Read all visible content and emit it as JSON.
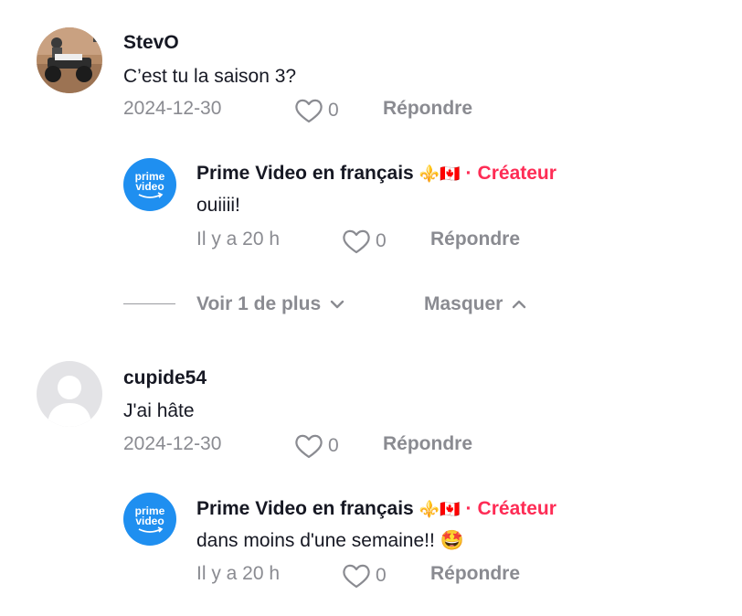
{
  "comments": [
    {
      "username": "StevO",
      "avatar_icon": "atv-photo",
      "text": "C’est tu la saison 3?",
      "date": "2024-12-30",
      "likes": "0",
      "reply_label": "Répondre",
      "reply": {
        "username": "Prime Video en français",
        "avatar_icon": "prime-video-logo",
        "avatar_text_line1": "prime",
        "avatar_text_line2": "video",
        "flags": "⚜️🇨🇦",
        "separator": "·",
        "badge": "Créateur",
        "text": "ouiiii!",
        "time": "Il y a 20 h",
        "likes": "0",
        "reply_label": "Répondre"
      },
      "thread_controls": {
        "more_label": "Voir 1 de plus",
        "hide_label": "Masquer"
      }
    },
    {
      "username": "cupide54",
      "avatar_icon": "default-avatar",
      "text": "J'ai hâte",
      "date": "2024-12-30",
      "likes": "0",
      "reply_label": "Répondre",
      "reply": {
        "username": "Prime Video en français",
        "avatar_icon": "prime-video-logo",
        "avatar_text_line1": "prime",
        "avatar_text_line2": "video",
        "flags": "⚜️🇨🇦",
        "separator": "·",
        "badge": "Créateur",
        "text": "dans moins d'une semaine!! 🤩",
        "time": "Il y a 20 h",
        "likes": "0",
        "reply_label": "Répondre"
      }
    }
  ],
  "colors": {
    "creator_accent": "#fe2c55",
    "prime_blue": "#1f8ff0",
    "meta_gray": "#8a8b91"
  }
}
